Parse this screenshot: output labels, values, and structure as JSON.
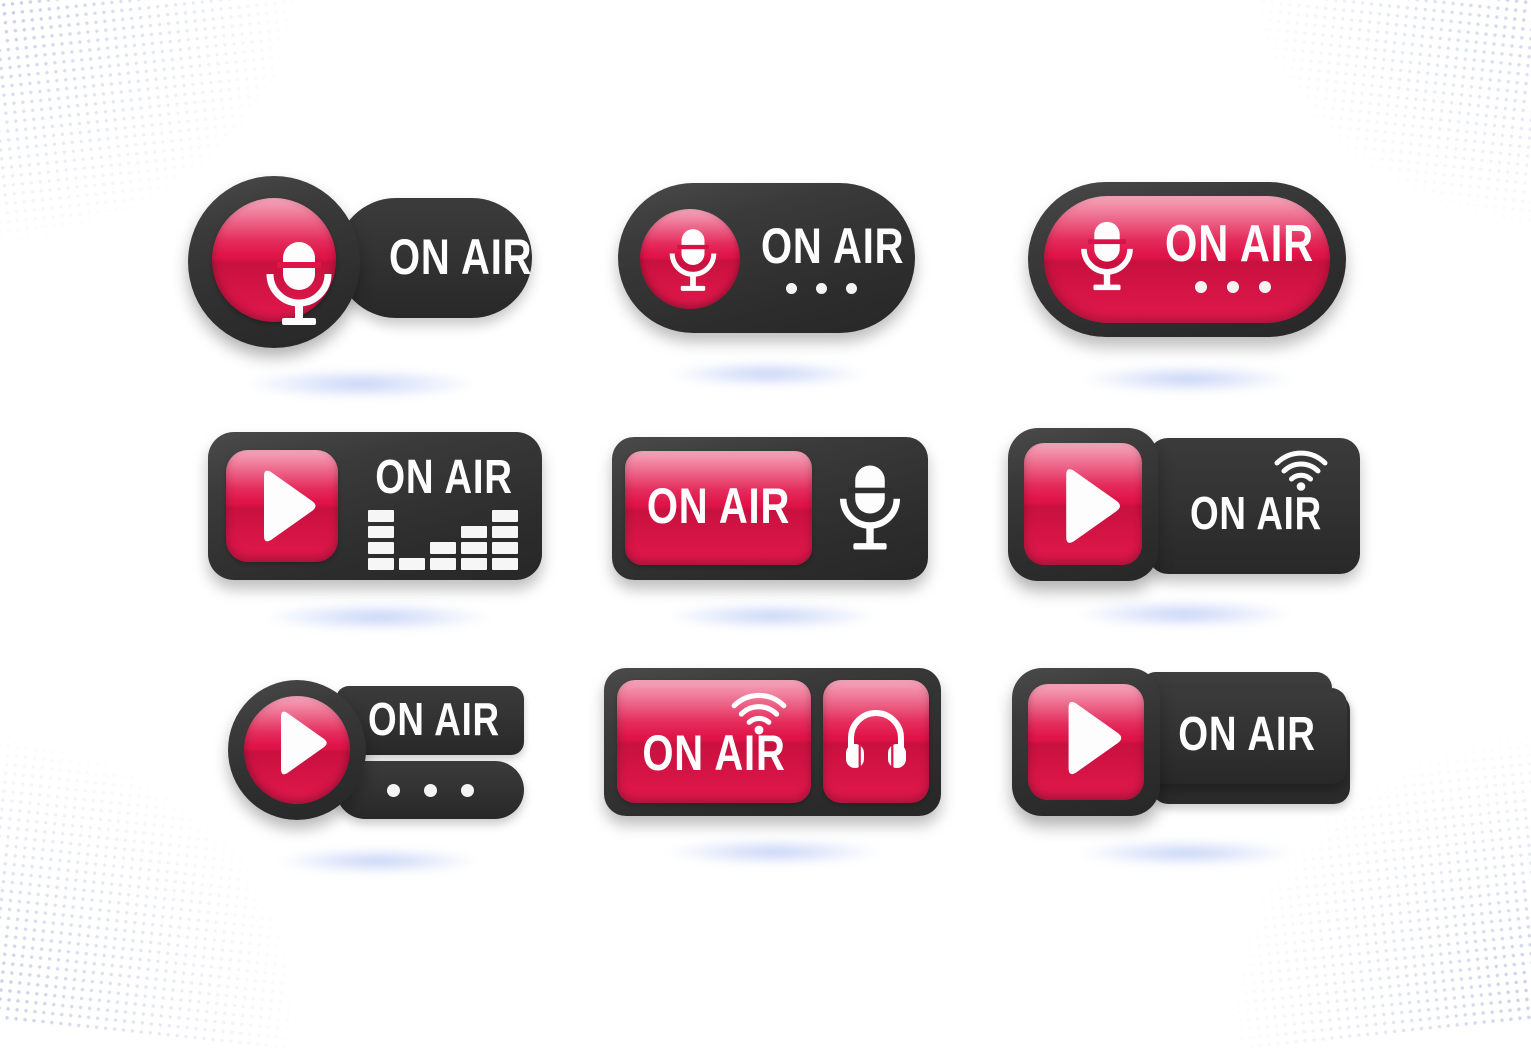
{
  "page": {
    "title": "ON AIR 3D Button Badge Set",
    "background_color": "#ffffff",
    "halftone_dot_color": "#b9c4e2",
    "glow_color": "#7d9aec"
  },
  "theme": {
    "accent_red_light": "#f04a72",
    "accent_red": "#e01448",
    "accent_red_deep": "#c8113f",
    "dark_body": "#2d2d2d",
    "dark_bezel": "#4a4a4a",
    "icon_white": "#fdfdfd"
  },
  "badges": [
    {
      "id": "badge-1",
      "name": "mic-circle-pill",
      "label": "ON AIR",
      "icons": [
        "microphone-icon"
      ],
      "has_dots": false,
      "icon_fill": "red",
      "body_fill": "dark"
    },
    {
      "id": "badge-2",
      "name": "mic-pill-dots",
      "label": "ON AIR",
      "icons": [
        "microphone-icon"
      ],
      "has_dots": true,
      "dots": 3,
      "icon_fill": "red",
      "body_fill": "dark"
    },
    {
      "id": "badge-3",
      "name": "mic-red-pill-dots",
      "label": "ON AIR",
      "icons": [
        "microphone-icon"
      ],
      "has_dots": true,
      "dots": 3,
      "icon_fill": "red",
      "body_fill": "red"
    },
    {
      "id": "badge-4",
      "name": "play-equalizer",
      "label": "ON AIR",
      "icons": [
        "play-icon",
        "equalizer-icon"
      ],
      "equalizer_levels": [
        4,
        1,
        2,
        3,
        4
      ],
      "equalizer_max": 4,
      "icon_fill": "red",
      "body_fill": "dark"
    },
    {
      "id": "badge-5",
      "name": "red-panel-mic",
      "label": "ON AIR",
      "icons": [
        "microphone-icon"
      ],
      "icon_fill": "white",
      "body_fill": "dark"
    },
    {
      "id": "badge-6",
      "name": "play-wifi-plate",
      "label": "ON AIR",
      "icons": [
        "play-icon",
        "wifi-icon"
      ],
      "icon_fill": "red",
      "body_fill": "dark"
    },
    {
      "id": "badge-7",
      "name": "play-circle-stacked-bars",
      "label": "ON AIR",
      "icons": [
        "play-icon"
      ],
      "has_dots": true,
      "dots": 3,
      "icon_fill": "red",
      "body_fill": "dark"
    },
    {
      "id": "badge-8",
      "name": "dual-panel-wifi-headphones",
      "label": "ON AIR",
      "icons": [
        "wifi-icon",
        "headphones-icon"
      ],
      "icon_fill": "red",
      "body_fill": "dark"
    },
    {
      "id": "badge-9",
      "name": "play-layered-plates",
      "label": "ON AIR",
      "icons": [
        "play-icon"
      ],
      "icon_fill": "red",
      "body_fill": "dark"
    }
  ]
}
